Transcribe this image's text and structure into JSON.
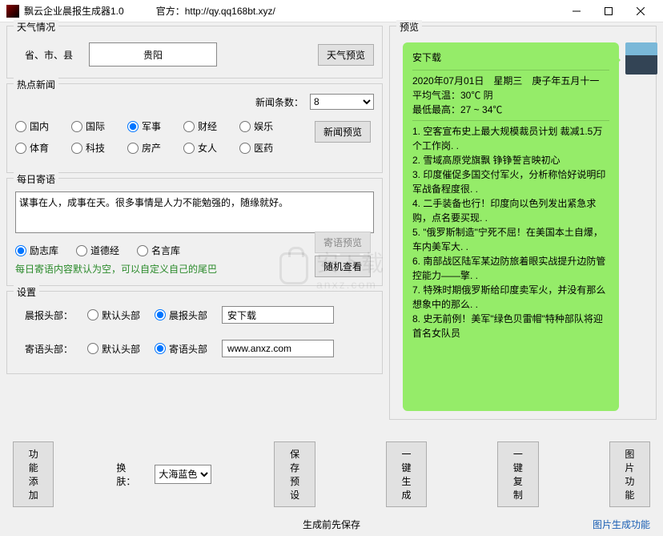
{
  "titlebar": {
    "title": "飘云企业晨报生成器1.0",
    "urlLabel": "官方：http://qy.qq168bt.xyz/"
  },
  "weather": {
    "groupTitle": "天气情况",
    "locationLabel": "省、市、县",
    "locationValue": "贵阳",
    "previewBtn": "天气预览"
  },
  "news": {
    "groupTitle": "热点新闻",
    "countLabel": "新闻条数：",
    "countValue": "8",
    "categories": [
      "国内",
      "国际",
      "军事",
      "财经",
      "娱乐",
      "体育",
      "科技",
      "房产",
      "女人",
      "医药"
    ],
    "selected": "军事",
    "previewBtn": "新闻预览"
  },
  "quote": {
    "groupTitle": "每日寄语",
    "text": "谋事在人，成事在天。很多事情是人力不能勉强的，随缘就好。",
    "sources": [
      "励志库",
      "道德经",
      "名言库"
    ],
    "selectedSource": "励志库",
    "previewBtn": "寄语预览",
    "randomBtn": "随机查看",
    "hint": "每日寄语内容默认为空，可以自定义自己的尾巴"
  },
  "settings": {
    "groupTitle": "设置",
    "row1": {
      "label": "晨报头部：",
      "opts": [
        "默认头部",
        "晨报头部"
      ],
      "selected": "晨报头部",
      "value": "安下载"
    },
    "row2": {
      "label": "寄语头部：",
      "opts": [
        "默认头部",
        "寄语头部"
      ],
      "selected": "寄语头部",
      "value": "www.anxz.com"
    }
  },
  "bottom": {
    "addFeature": "功能添加",
    "themeLabel": "换肤：",
    "themeValue": "大海蓝色",
    "savePreset": "保存预设",
    "generate": "一键生成",
    "copy": "一键复制",
    "imageFn": "图片功能"
  },
  "footer": {
    "center": "生成前先保存",
    "right": "图片生成功能"
  },
  "preview": {
    "groupTitle": "预览",
    "header": "安下载",
    "dateLine": "2020年07月01日　星期三　庚子年五月十一",
    "tempAvg": "平均气温：30℃ 阴",
    "tempRange": "最低最高：27 ~ 34℃",
    "items": [
      "1. 空客宣布史上最大规模裁员计划 裁减1.5万个工作岗. .",
      "2. 雪域高原党旗飘 铮铮誓言映初心",
      "3. 印度催促多国交付军火，分析称恰好说明印军战备程度很. .",
      "4. 二手装备也行！印度向以色列发出紧急求购，点名要买现. .",
      "5. \"俄罗斯制造\"宁死不屈！在美国本土自爆，车内美军大. .",
      "6. 南部战区陆军某边防旅着眼实战提升边防管控能力——擎. .",
      "7. 特殊时期俄罗斯给印度卖军火，并没有那么想象中的那么. .",
      "8. 史无前例！美军\"绿色贝雷帽\"特种部队将迎首名女队员"
    ]
  },
  "watermark": {
    "text": "安下载",
    "url": "anxz.com"
  }
}
